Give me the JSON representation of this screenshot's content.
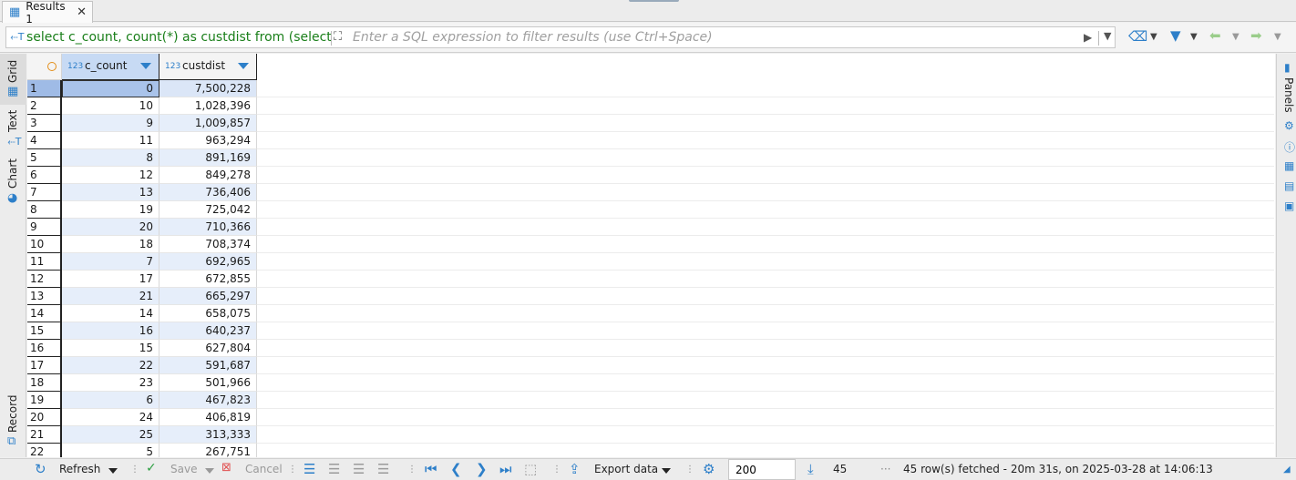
{
  "tab": {
    "label": "Results 1",
    "close": "✕"
  },
  "filter": {
    "sql": "select c_count, count(*) as custdist from (select c_c",
    "placeholder": "Enter a SQL expression to filter results (use Ctrl+Space)"
  },
  "side_tabs": [
    "Grid",
    "Text",
    "Chart",
    "Record"
  ],
  "right_panel": {
    "label": "Panels"
  },
  "columns": [
    {
      "type": "123",
      "name": "c_count"
    },
    {
      "type": "123",
      "name": "custdist"
    }
  ],
  "rows": [
    [
      "1",
      "0",
      "7,500,228"
    ],
    [
      "2",
      "10",
      "1,028,396"
    ],
    [
      "3",
      "9",
      "1,009,857"
    ],
    [
      "4",
      "11",
      "963,294"
    ],
    [
      "5",
      "8",
      "891,169"
    ],
    [
      "6",
      "12",
      "849,278"
    ],
    [
      "7",
      "13",
      "736,406"
    ],
    [
      "8",
      "19",
      "725,042"
    ],
    [
      "9",
      "20",
      "710,366"
    ],
    [
      "10",
      "18",
      "708,374"
    ],
    [
      "11",
      "7",
      "692,965"
    ],
    [
      "12",
      "17",
      "672,855"
    ],
    [
      "13",
      "21",
      "665,297"
    ],
    [
      "14",
      "14",
      "658,075"
    ],
    [
      "15",
      "16",
      "640,237"
    ],
    [
      "16",
      "15",
      "627,804"
    ],
    [
      "17",
      "22",
      "591,687"
    ],
    [
      "18",
      "23",
      "501,966"
    ],
    [
      "19",
      "6",
      "467,823"
    ],
    [
      "20",
      "24",
      "406,819"
    ],
    [
      "21",
      "25",
      "313,333"
    ],
    [
      "22",
      "5",
      "267,751"
    ]
  ],
  "toolbar": {
    "refresh": "Refresh",
    "save": "Save",
    "cancel": "Cancel",
    "export": "Export data",
    "limit": "200",
    "count": "45",
    "dots": "···",
    "status": "45 row(s) fetched - 20m 31s, on 2025-03-28 at 14:06:13"
  },
  "colors": {
    "accent": "#2d7fc9",
    "sql_text": "#1a7f1a",
    "row_alt": "#e6eefa",
    "selection": "#a9c3ea"
  }
}
